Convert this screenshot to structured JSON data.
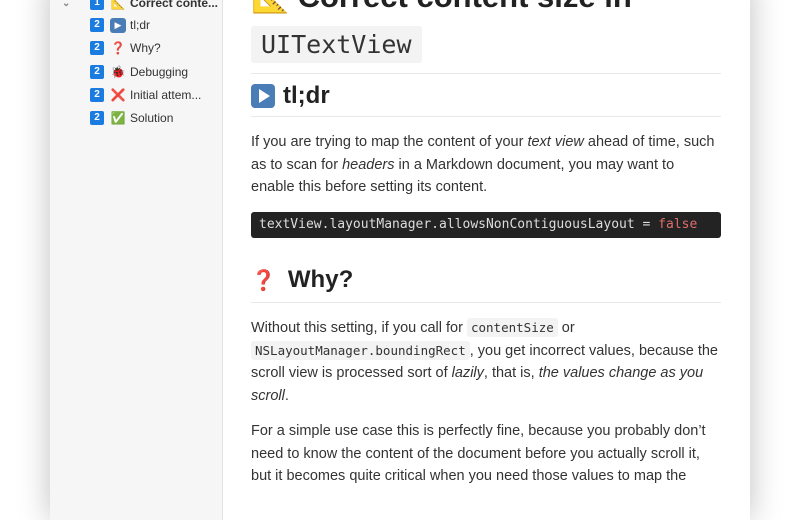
{
  "sidebar": {
    "items": [
      {
        "level": "1",
        "icon": "📐",
        "label": "Correct conte..."
      },
      {
        "level": "2",
        "icon": "▶",
        "label": "tl;dr"
      },
      {
        "level": "2",
        "icon": "❓",
        "label": "Why?"
      },
      {
        "level": "2",
        "icon": "🐞",
        "label": "Debugging"
      },
      {
        "level": "2",
        "icon": "❌",
        "label": "Initial attem..."
      },
      {
        "level": "2",
        "icon": "✅",
        "label": "Solution"
      }
    ]
  },
  "doc": {
    "title_icon": "📐",
    "title": "Correct content size in",
    "title_code": "UITextView",
    "h_tldr": "tl;dr",
    "p1": {
      "a": "If you are trying to map the content of your ",
      "b": "text view",
      "c": " ahead of time, such as to scan for ",
      "d": "headers",
      "e": " in a Markdown document, you may want to enable this before setting its content."
    },
    "code": {
      "text": "textView.layoutManager.allowsNonContiguousLayout = ",
      "kw": "false"
    },
    "h_why_icon": "❓",
    "h_why": "Why?",
    "p2": {
      "a": "Without this setting, if you call for ",
      "c1": "contentSize",
      "b": " or ",
      "c2": "NSLayoutManager.boundingRect",
      "c": ", you get incorrect values, because the scroll view is processed sort of ",
      "d": "lazily",
      "e": ", that is, ",
      "f": "the values change as you scroll",
      "g": "."
    },
    "p3": "For a simple use case this is perfectly fine, because you probably don’t need to know the content of the document before you actually scroll it, but it becomes quite critical when you need those values to map the"
  }
}
